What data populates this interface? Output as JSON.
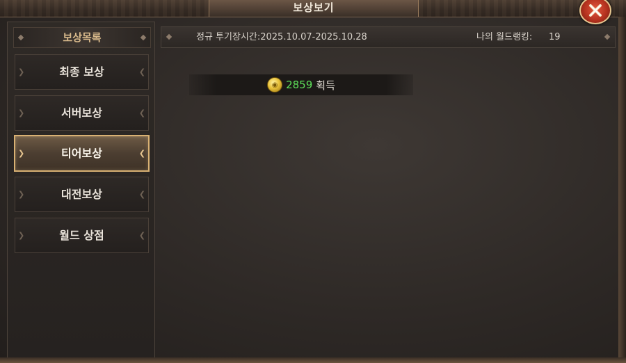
{
  "window": {
    "title": "보상보기",
    "close_icon": "close-x-icon"
  },
  "sidebar": {
    "header": "보상목록",
    "items": [
      {
        "label": "최종 보상",
        "active": false
      },
      {
        "label": "서버보상",
        "active": false
      },
      {
        "label": "티어보상",
        "active": true
      },
      {
        "label": "대전보상",
        "active": false
      },
      {
        "label": "월드 상점",
        "active": false
      }
    ]
  },
  "info": {
    "period": "정규 투기장시간:2025.10.07-2025.10.28",
    "rank_label": "나의 월드랭킹:",
    "rank_value": "19"
  },
  "reward": {
    "icon": "gold-coin-icon",
    "amount": "2859",
    "suffix": "획득"
  },
  "colors": {
    "accent_gold": "#d9b173",
    "reward_green": "#5ee05a",
    "close_red": "#b5321f"
  }
}
